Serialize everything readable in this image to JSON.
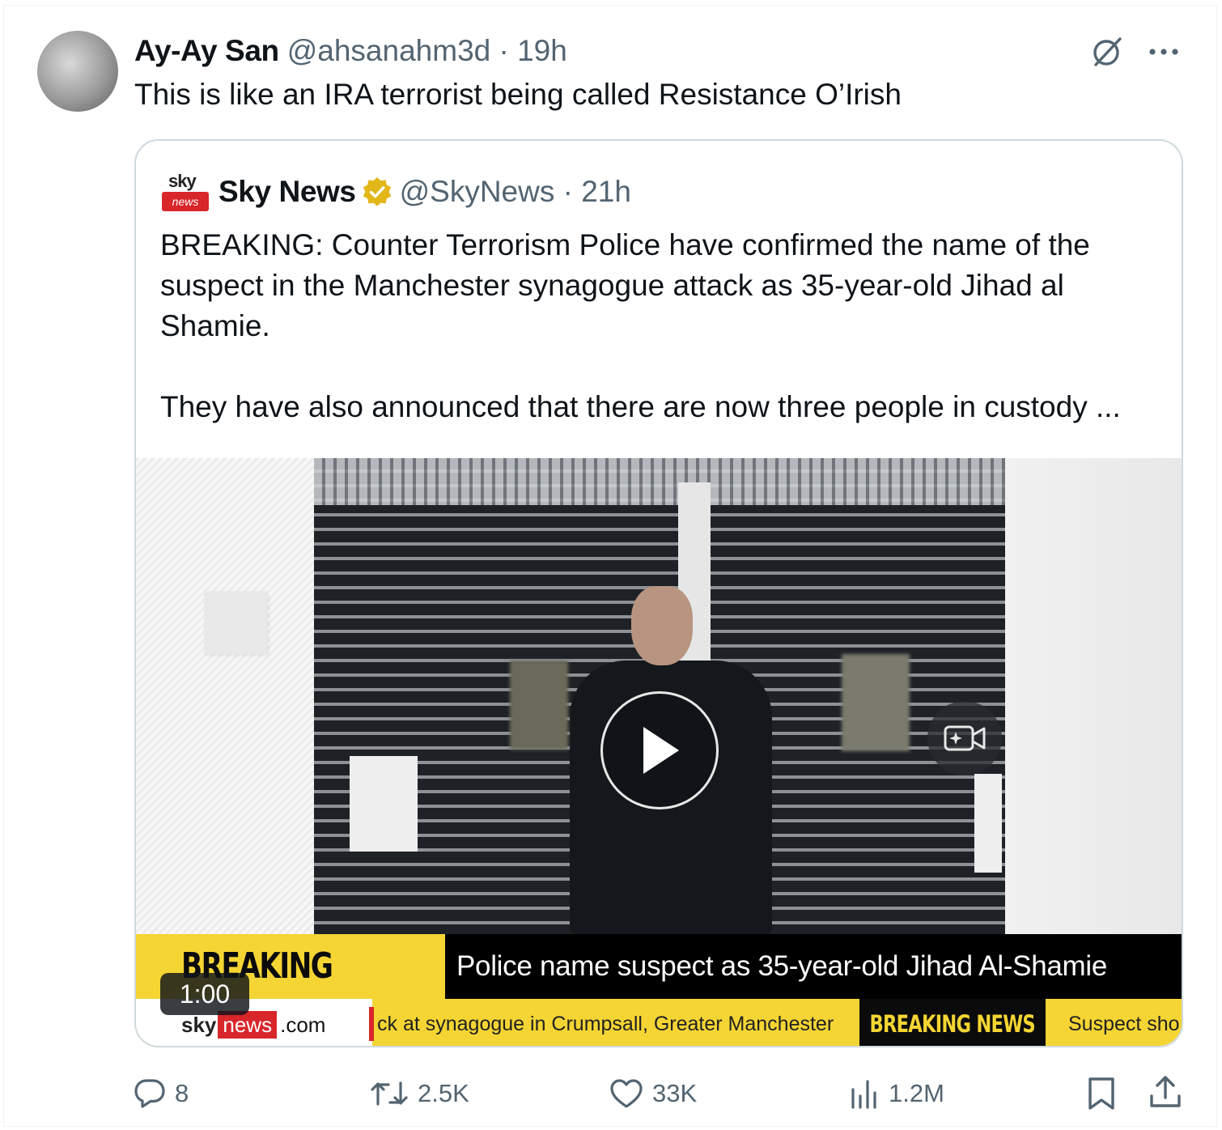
{
  "tweet": {
    "author": {
      "display_name": "Ay-Ay San",
      "handle": "@ahsanahm3d",
      "time": "19h"
    },
    "meta": "@ahsanahm3d · 19h",
    "text": "This is like an IRA terrorist being called Resistance O’Irish"
  },
  "quote": {
    "author": {
      "display_name": "Sky News",
      "handle": "@SkyNews",
      "time": "21h",
      "verified": true
    },
    "meta": "@SkyNews · 21h",
    "logo": {
      "sky": "sky",
      "news": "news"
    },
    "paragraph1": "BREAKING: Counter Terrorism Police have confirmed the name of the suspect in the Manchester synagogue attack as 35-year-old Jihad al Shamie.",
    "paragraph2": "They have also announced that there are now three people in custody ...",
    "video": {
      "duration": "1:00",
      "ticker_label": "BREAKING NEWS",
      "headline": "Police name suspect as 35-year-old Jihad Al-Shamie",
      "sub_logo_sky": "sky",
      "sub_logo_news": "news",
      "sub_logo_com": ".com",
      "sub_ticker_text": "ck at synagogue in Crumpsall, Greater Manchester",
      "sub_ticker_label": "BREAKING NEWS",
      "sub_ticker_text2": "Suspect sho"
    }
  },
  "actions": {
    "replies": "8",
    "reposts": "2.5K",
    "likes": "33K",
    "views": "1.2M"
  },
  "colors": {
    "accent_blue": "#1d9bf0",
    "muted_text": "#536471",
    "sky_yellow": "#f5d533",
    "sky_red": "#d8262b",
    "verified_gold": "#e2b719"
  },
  "icons": [
    "grok-icon",
    "more-icon",
    "verified-icon",
    "play-icon",
    "video-camera-icon",
    "reply-icon",
    "retweet-icon",
    "like-icon",
    "views-icon",
    "bookmark-icon",
    "share-icon"
  ]
}
